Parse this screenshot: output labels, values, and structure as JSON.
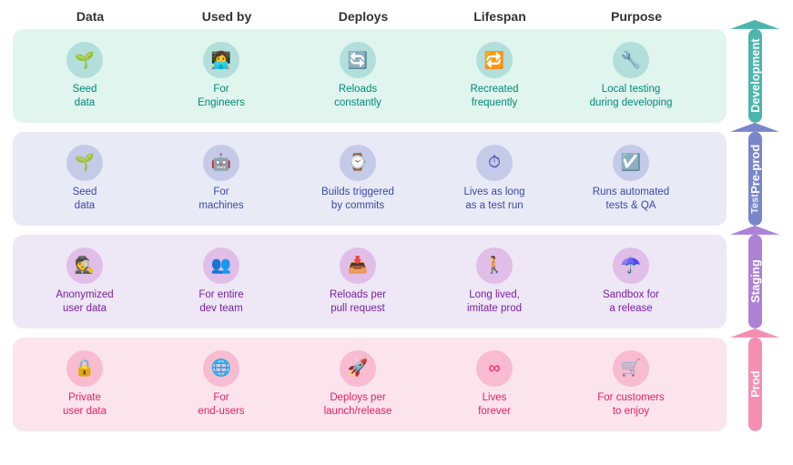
{
  "headers": [
    "Data",
    "Used by",
    "Deploys",
    "Lifespan",
    "Purpose"
  ],
  "sections": [
    {
      "id": "development",
      "label": "Development",
      "theme": "dev",
      "cells": [
        {
          "icon": "🌱",
          "text": "Seed\ndata"
        },
        {
          "icon": "👩‍💻",
          "text": "For\nEngineers"
        },
        {
          "icon": "🔄",
          "text": "Reloads\nconstantly"
        },
        {
          "icon": "🔁",
          "text": "Recreated\nfrequently"
        },
        {
          "icon": "🔧",
          "text": "Local testing\nduring developing"
        }
      ]
    },
    {
      "id": "test",
      "label": "Pre-prod",
      "sublabel": "Test",
      "theme": "test",
      "cells": [
        {
          "icon": "🌱",
          "text": "Seed\ndata"
        },
        {
          "icon": "🤖",
          "text": "For\nmachines"
        },
        {
          "icon": "⌚",
          "text": "Builds triggered\nby commits"
        },
        {
          "icon": "⏱",
          "text": "Lives as long\nas a test run"
        },
        {
          "icon": "☑️",
          "text": "Runs automated\ntests & QA"
        }
      ]
    },
    {
      "id": "staging",
      "label": "Staging",
      "theme": "staging",
      "cells": [
        {
          "icon": "🕵️",
          "text": "Anonymized\nuser data"
        },
        {
          "icon": "👥",
          "text": "For entire\ndev team"
        },
        {
          "icon": "📥",
          "text": "Reloads per\npull request"
        },
        {
          "icon": "🚶",
          "text": "Long lived,\nimitate prod"
        },
        {
          "icon": "☂️",
          "text": "Sandbox for\na release"
        }
      ]
    },
    {
      "id": "prod",
      "label": "Prod",
      "theme": "prod",
      "cells": [
        {
          "icon": "🔒",
          "text": "Private\nuser data"
        },
        {
          "icon": "🌐",
          "text": "For\nend-users"
        },
        {
          "icon": "🚀",
          "text": "Deploys per\nlaunch/release"
        },
        {
          "icon": "∞",
          "text": "Lives\nforever"
        },
        {
          "icon": "🛒",
          "text": "For customers\nto enjoy"
        }
      ]
    }
  ]
}
